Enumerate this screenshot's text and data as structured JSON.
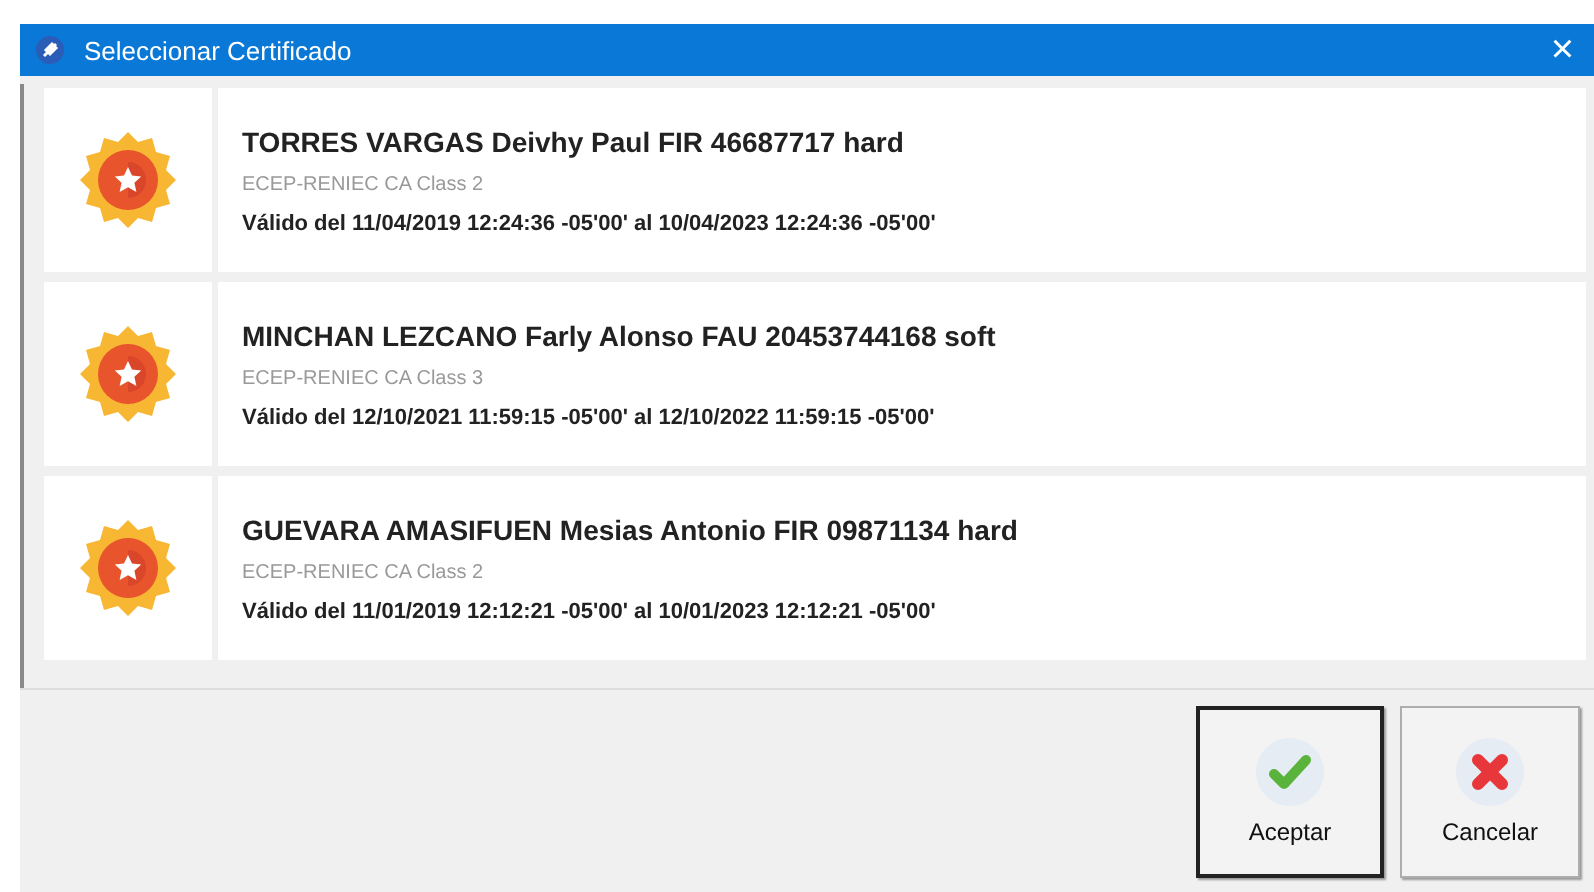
{
  "window": {
    "title": "Seleccionar Certificado",
    "close": "×"
  },
  "certificates": [
    {
      "name": "TORRES VARGAS Deivhy Paul FIR 46687717 hard",
      "issuer": "ECEP-RENIEC CA Class 2",
      "validity": "Válido del 11/04/2019 12:24:36 -05'00' al 10/04/2023 12:24:36 -05'00'"
    },
    {
      "name": "MINCHAN LEZCANO Farly Alonso FAU 20453744168 soft",
      "issuer": "ECEP-RENIEC CA Class 3",
      "validity": "Válido del 12/10/2021 11:59:15 -05'00' al 12/10/2022 11:59:15 -05'00'"
    },
    {
      "name": "GUEVARA AMASIFUEN Mesias Antonio FIR 09871134 hard",
      "issuer": "ECEP-RENIEC CA Class 2",
      "validity": "Válido del 11/01/2019 12:12:21 -05'00' al 10/01/2023 12:12:21 -05'00'"
    }
  ],
  "buttons": [
    {
      "label": "Aceptar",
      "kind": "accept",
      "focused": true
    },
    {
      "label": "Cancelar",
      "kind": "cancel",
      "focused": false
    }
  ]
}
